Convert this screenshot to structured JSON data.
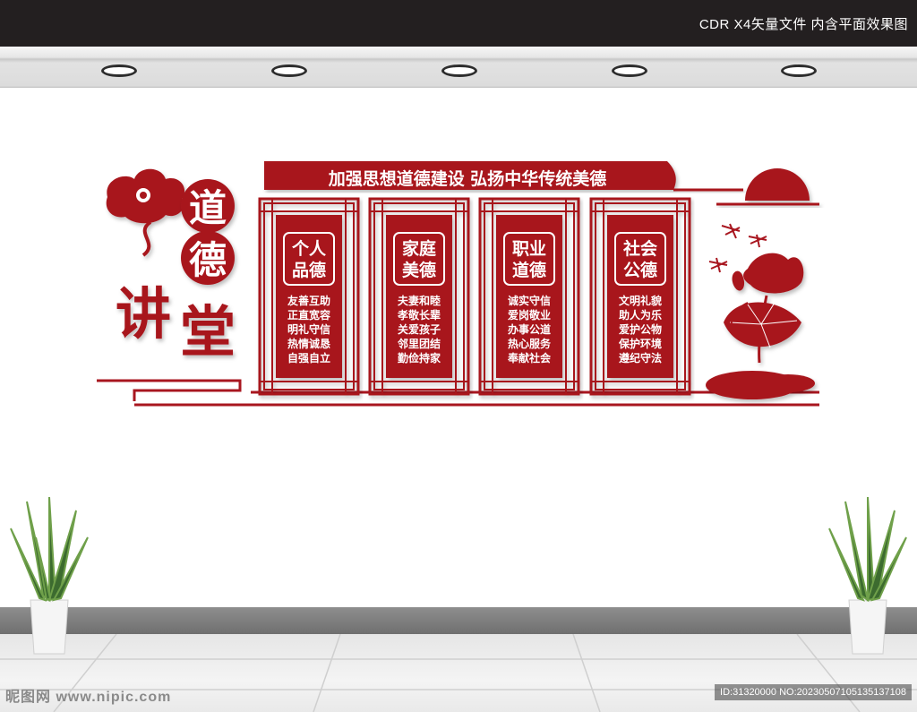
{
  "header": {
    "label": "CDR X4矢量文件  内含平面效果图"
  },
  "logo": {
    "chars": [
      "道",
      "德",
      "讲",
      "堂"
    ]
  },
  "banner": {
    "slogan": "加强思想道德建设  弘扬中华传统美德"
  },
  "panels": [
    {
      "title_line1": "个人",
      "title_line2": "品德",
      "items": [
        "友善互助",
        "正直宽容",
        "明礼守信",
        "热情诚恳",
        "自强自立"
      ]
    },
    {
      "title_line1": "家庭",
      "title_line2": "美德",
      "items": [
        "夫妻和睦",
        "孝敬长辈",
        "关爱孩子",
        "邻里团结",
        "勤俭持家"
      ]
    },
    {
      "title_line1": "职业",
      "title_line2": "道德",
      "items": [
        "诚实守信",
        "爱岗敬业",
        "办事公道",
        "热心服务",
        "奉献社会"
      ]
    },
    {
      "title_line1": "社会",
      "title_line2": "公德",
      "items": [
        "文明礼貌",
        "助人为乐",
        "爱护公物",
        "保护环境",
        "遵纪守法"
      ]
    }
  ],
  "footer": {
    "watermark": "昵图网 www.nipic.com",
    "id_text": "ID:31320000 NO:20230507105135137108"
  },
  "colors": {
    "accent": "#a8161f",
    "dark": "#231f20",
    "wall": "#ffffff"
  },
  "icons": [
    "auspicious-cloud-icon",
    "sun-icon",
    "lotus-icon",
    "dragonfly-icon",
    "plant-icon"
  ]
}
